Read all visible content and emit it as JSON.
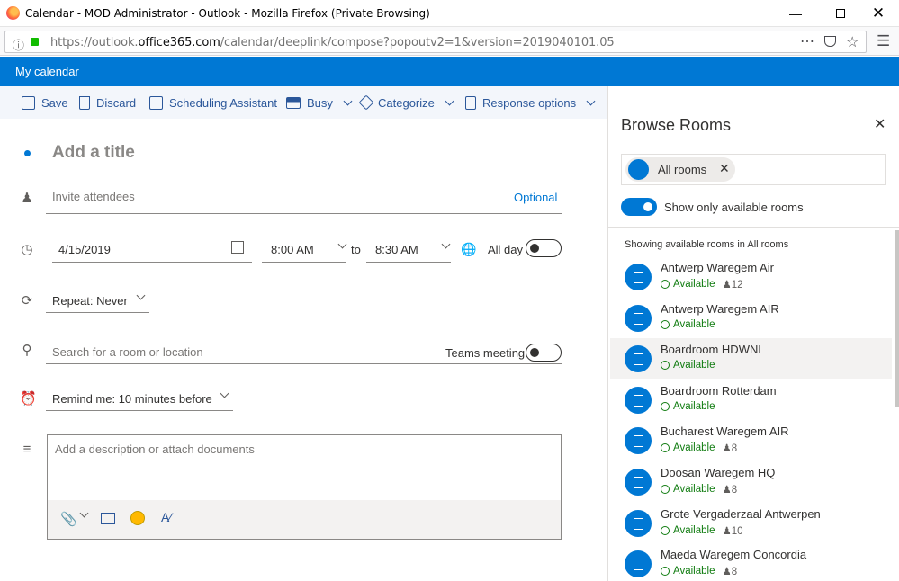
{
  "browser": {
    "window_title": "Calendar - MOD Administrator - Outlook - Mozilla Firefox (Private Browsing)",
    "url_prefix": "https://outlook.",
    "url_domain": "office365.com",
    "url_path": "/calendar/deeplink/compose?popoutv2=1&version=2019040101.05"
  },
  "app": {
    "header_title": "My calendar"
  },
  "toolbar": {
    "save": "Save",
    "discard": "Discard",
    "scheduling": "Scheduling Assistant",
    "busy": "Busy",
    "categorize": "Categorize",
    "response": "Response options"
  },
  "form": {
    "title_placeholder": "Add a title",
    "attendees_placeholder": "Invite attendees",
    "optional_link": "Optional",
    "start_date": "4/15/2019",
    "start_time": "8:00 AM",
    "to_label": "to",
    "end_time": "8:30 AM",
    "allday_label": "All day",
    "repeat": "Repeat: Never",
    "location_placeholder": "Search for a room or location",
    "teams_label": "Teams meeting",
    "remind": "Remind me: 10 minutes before",
    "description_placeholder": "Add a description or attach documents"
  },
  "panel": {
    "title": "Browse Rooms",
    "chip": "All rooms",
    "toggle_label": "Show only available rooms",
    "section": "Showing available rooms in All rooms",
    "rooms": [
      {
        "name": "Antwerp Waregem Air",
        "status": "Available",
        "capacity": "12"
      },
      {
        "name": "Antwerp Waregem AIR",
        "status": "Available",
        "capacity": ""
      },
      {
        "name": "Boardroom HDWNL",
        "status": "Available",
        "capacity": ""
      },
      {
        "name": "Boardroom Rotterdam",
        "status": "Available",
        "capacity": ""
      },
      {
        "name": "Bucharest Waregem AIR",
        "status": "Available",
        "capacity": "8"
      },
      {
        "name": "Doosan Waregem HQ",
        "status": "Available",
        "capacity": "8"
      },
      {
        "name": "Grote Vergaderzaal Antwerpen",
        "status": "Available",
        "capacity": "10"
      },
      {
        "name": "Maeda Waregem Concordia",
        "status": "Available",
        "capacity": "8"
      }
    ]
  },
  "colors": {
    "accent": "#0078d4",
    "available": "#107c10",
    "toolbar_text": "#2b579a"
  }
}
